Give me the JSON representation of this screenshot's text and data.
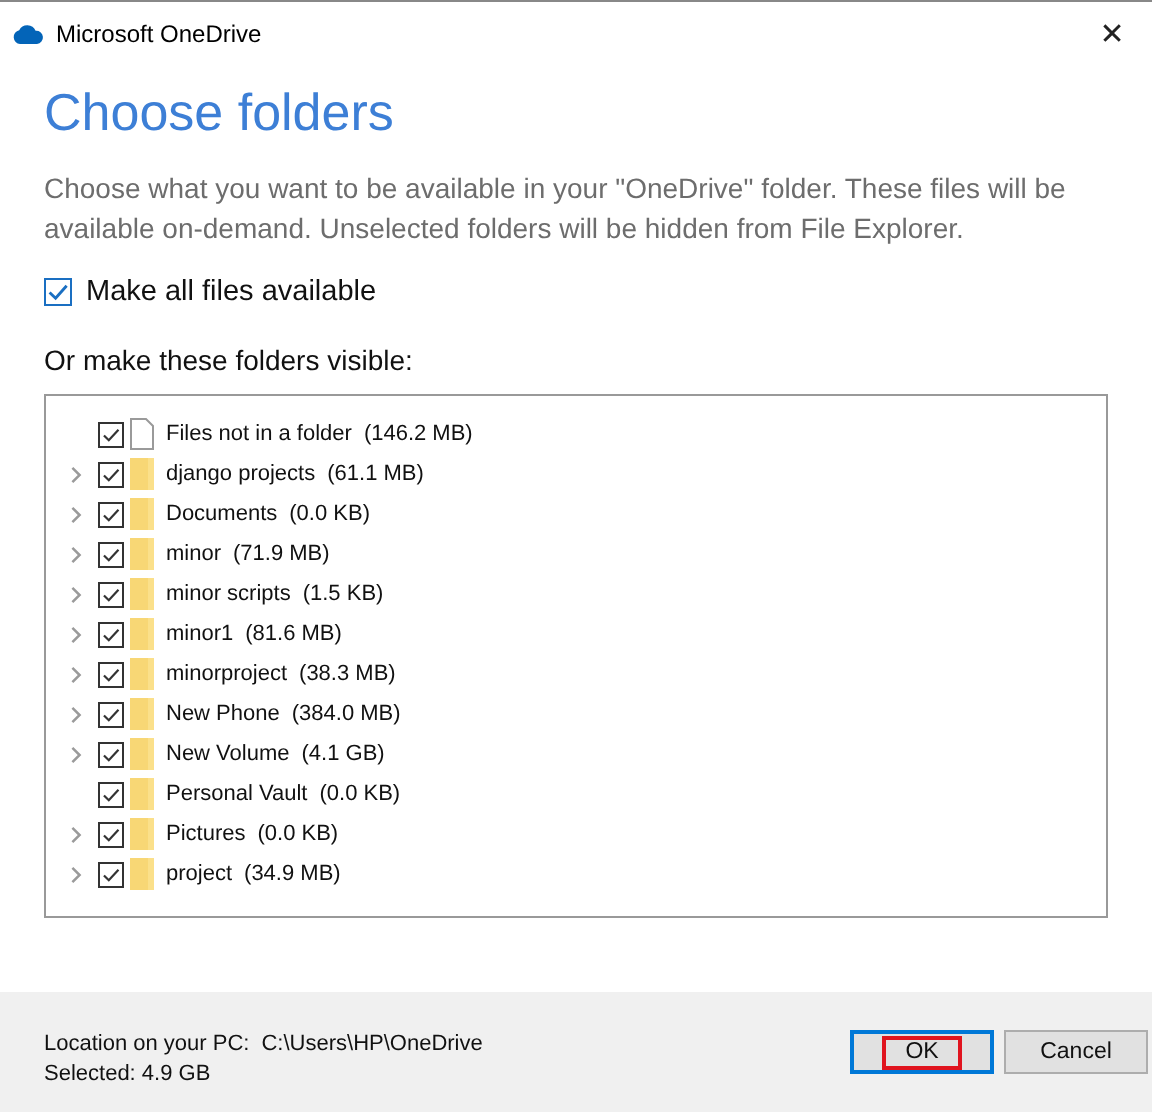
{
  "window": {
    "title": "Microsoft OneDrive",
    "close": "✕"
  },
  "heading": "Choose folders",
  "description": "Choose what you want to be available in your \"OneDrive\" folder. These files will be available on-demand. Unselected folders will be hidden from File Explorer.",
  "make_all": {
    "label": "Make all files available",
    "checked": true
  },
  "list_label": "Or make these folders visible:",
  "folders": [
    {
      "kind": "file",
      "name": "Files not in a folder",
      "size": "(146.2 MB)",
      "checked": true,
      "expandable": false
    },
    {
      "kind": "folder",
      "name": "django projects",
      "size": "(61.1 MB)",
      "checked": true,
      "expandable": true
    },
    {
      "kind": "folder",
      "name": "Documents",
      "size": "(0.0 KB)",
      "checked": true,
      "expandable": true
    },
    {
      "kind": "folder",
      "name": "minor",
      "size": "(71.9 MB)",
      "checked": true,
      "expandable": true
    },
    {
      "kind": "folder",
      "name": "minor scripts",
      "size": "(1.5 KB)",
      "checked": true,
      "expandable": true
    },
    {
      "kind": "folder",
      "name": "minor1",
      "size": "(81.6 MB)",
      "checked": true,
      "expandable": true
    },
    {
      "kind": "folder",
      "name": "minorproject",
      "size": "(38.3 MB)",
      "checked": true,
      "expandable": true
    },
    {
      "kind": "folder",
      "name": "New Phone",
      "size": "(384.0 MB)",
      "checked": true,
      "expandable": true
    },
    {
      "kind": "folder",
      "name": "New Volume",
      "size": "(4.1 GB)",
      "checked": true,
      "expandable": true
    },
    {
      "kind": "folder",
      "name": "Personal Vault",
      "size": "(0.0 KB)",
      "checked": true,
      "expandable": false
    },
    {
      "kind": "folder",
      "name": "Pictures",
      "size": "(0.0 KB)",
      "checked": true,
      "expandable": true
    },
    {
      "kind": "folder",
      "name": "project",
      "size": "(34.9 MB)",
      "checked": true,
      "expandable": true
    }
  ],
  "footer": {
    "location_label": "Location on your PC:",
    "location": "C:\\Users\\HP\\OneDrive",
    "selected": "Selected: 4.9 GB"
  },
  "buttons": [
    {
      "label": "OK",
      "default": true,
      "highlighted": true
    },
    {
      "label": "Cancel",
      "default": false,
      "highlighted": false
    }
  ]
}
